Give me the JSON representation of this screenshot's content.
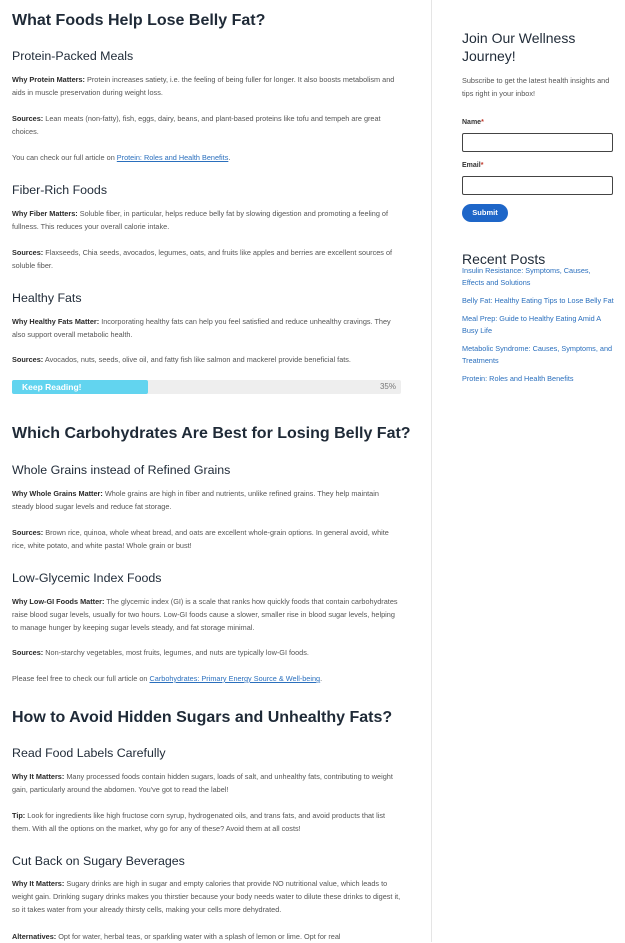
{
  "section1": {
    "title": "What Foods Help Lose Belly Fat?",
    "protein": {
      "heading": "Protein-Packed Meals",
      "why_label": "Why Protein Matters:",
      "why_text": " Protein increases satiety, i.e. the feeling of being fuller for longer. It also boosts metabolism and aids in muscle preservation during weight loss.",
      "sources_label": "Sources:",
      "sources_text": " Lean meats (non-fatty), fish, eggs, dairy, beans, and plant-based proteins like tofu and tempeh are great choices.",
      "link_prefix": "You can check our full article on ",
      "link_text": "Protein: Roles and Health Benefits",
      "link_suffix": "."
    },
    "fiber": {
      "heading": "Fiber-Rich Foods",
      "why_label": "Why Fiber Matters:",
      "why_text": " Soluble fiber, in particular, helps reduce belly fat by slowing digestion and promoting a feeling of fullness. This reduces your overall calorie intake.",
      "sources_label": "Sources:",
      "sources_text": " Flaxseeds, Chia seeds, avocados, legumes, oats, and fruits like apples and berries are excellent sources of soluble fiber."
    },
    "fats": {
      "heading": "Healthy Fats",
      "why_label": "Why Healthy Fats Matter:",
      "why_text": " Incorporating healthy fats can help you feel satisfied and reduce unhealthy cravings. They also support overall metabolic health.",
      "sources_label": "Sources:",
      "sources_text": " Avocados, nuts, seeds, olive oil, and fatty fish like salmon and mackerel provide beneficial fats."
    }
  },
  "progress": {
    "label": "Keep Reading!",
    "percent_text": "35%",
    "fraction": 0.35,
    "fill_color": "#62d4ef"
  },
  "section2": {
    "title": "Which Carbohydrates Are Best for Losing Belly Fat?",
    "grains": {
      "heading": "Whole Grains instead of Refined Grains",
      "why_label": "Why Whole Grains Matter:",
      "why_text": " Whole grains are high in fiber and nutrients, unlike refined grains. They help maintain steady blood sugar levels and reduce fat storage.",
      "sources_label": "Sources:",
      "sources_text": " Brown rice, quinoa, whole wheat bread, and oats are excellent whole-grain options. In general avoid, white rice, white potato, and white pasta! Whole grain or bust!"
    },
    "lowgi": {
      "heading": "Low-Glycemic Index Foods",
      "why_label": "Why Low-GI Foods Matter:",
      "why_text": " The glycemic index (GI) is a scale that ranks how quickly foods that contain carbohydrates raise blood sugar levels, usually for two hours. Low-GI foods cause a slower, smaller rise in blood sugar levels, helping to manage hunger by keeping sugar levels steady, and fat storage minimal.",
      "sources_label": "Sources:",
      "sources_text": " Non-starchy vegetables, most fruits, legumes, and nuts are typically low-GI foods.",
      "link_prefix": "Please feel free to check our full article on ",
      "link_text": "Carbohydrates: Primary Energy Source & Well-being",
      "link_suffix": "."
    }
  },
  "section3": {
    "title": "How to Avoid Hidden Sugars and Unhealthy Fats?",
    "labels": {
      "heading": "Read Food Labels Carefully",
      "why_label": "Why It Matters:",
      "why_text": " Many processed foods contain hidden sugars, loads of salt, and unhealthy fats, contributing to weight gain, particularly around the abdomen. You've got to read the label!",
      "tip_label": "Tip:",
      "tip_text": " Look for ingredients like high fructose corn syrup, hydrogenated oils, and trans fats, and avoid products that list them. With all the options on the market, why go for any of these? Avoid them at all costs!"
    },
    "beverages": {
      "heading": "Cut Back on Sugary Beverages",
      "why_label": "Why It Matters:",
      "why_text": " Sugary drinks are high in sugar and empty calories that provide NO nutritional value, which leads to weight gain. Drinking sugary drinks makes you thirstier because your body needs water to dilute these drinks to digest it, so it takes water from your already thirsty cells, making your cells more dehydrated.",
      "alt_label": "Alternatives:",
      "alt_text": " Opt for water, herbal teas, or sparkling water with a splash of lemon or lime. Opt for real"
    }
  },
  "sidebar": {
    "join_title": "Join Our Wellness Journey!",
    "subscribe_text": "Subscribe to get the latest health insights and tips right in your inbox!",
    "name_label": "Name",
    "email_label": "Email",
    "required_mark": "*",
    "submit_label": "Submit",
    "submit_color": "#1e66c8",
    "recent_title": "Recent Posts",
    "recent_posts": [
      "Insulin Resistance: Symptoms, Causes, Effects and Solutions",
      "Belly Fat: Healthy Eating Tips to Lose Belly Fat",
      "Meal Prep: Guide to Healthy Eating Amid A Busy Life",
      "Metabolic Syndrome: Causes, Symptoms, and Treatments",
      "Protein: Roles and Health Benefits"
    ]
  }
}
